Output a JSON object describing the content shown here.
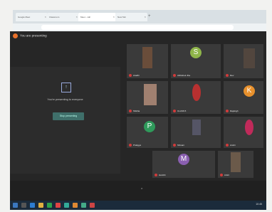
{
  "browser": {
    "tabs": [
      {
        "label": "Google Meet",
        "active": false
      },
      {
        "label": "Classroom",
        "active": false
      },
      {
        "label": "Meet - call",
        "active": true
      },
      {
        "label": "New Tab",
        "active": false
      }
    ],
    "new_tab_label": "+"
  },
  "meeting": {
    "presenting_banner": "You are presenting",
    "share_message": "You're presenting to everyone",
    "stop_button": "Stop presenting",
    "toolbar_glyph": "^",
    "participants": [
      {
        "name": "Aradhi",
        "type": "photo",
        "color": "#6a4d3a"
      },
      {
        "name": "Abhishek Jha",
        "type": "letter",
        "letter": "S",
        "color": "#8fb54a"
      },
      {
        "name": "Dev",
        "type": "photo",
        "color": "#52463e"
      },
      {
        "name": "Shikha",
        "type": "photo",
        "color": "#a08070"
      },
      {
        "name": "CLASS 5",
        "type": "photo",
        "color": "#b83030"
      },
      {
        "name": "Rajsingh",
        "type": "letter",
        "letter": "K",
        "color": "#e8912d"
      },
      {
        "name": "Pratigya",
        "type": "letter",
        "letter": "P",
        "color": "#2f9a5b"
      },
      {
        "name": "Shivani",
        "type": "photo",
        "color": "#555566"
      },
      {
        "name": "Anshi",
        "type": "photo",
        "color": "#c02a5a"
      },
      {
        "name": "Harshit",
        "type": "letter",
        "letter": "M",
        "color": "#8a5fb0"
      },
      {
        "name": "Ankit",
        "type": "photo",
        "color": "#6b5a4a"
      }
    ]
  },
  "taskbar": {
    "clock": "10:45"
  }
}
